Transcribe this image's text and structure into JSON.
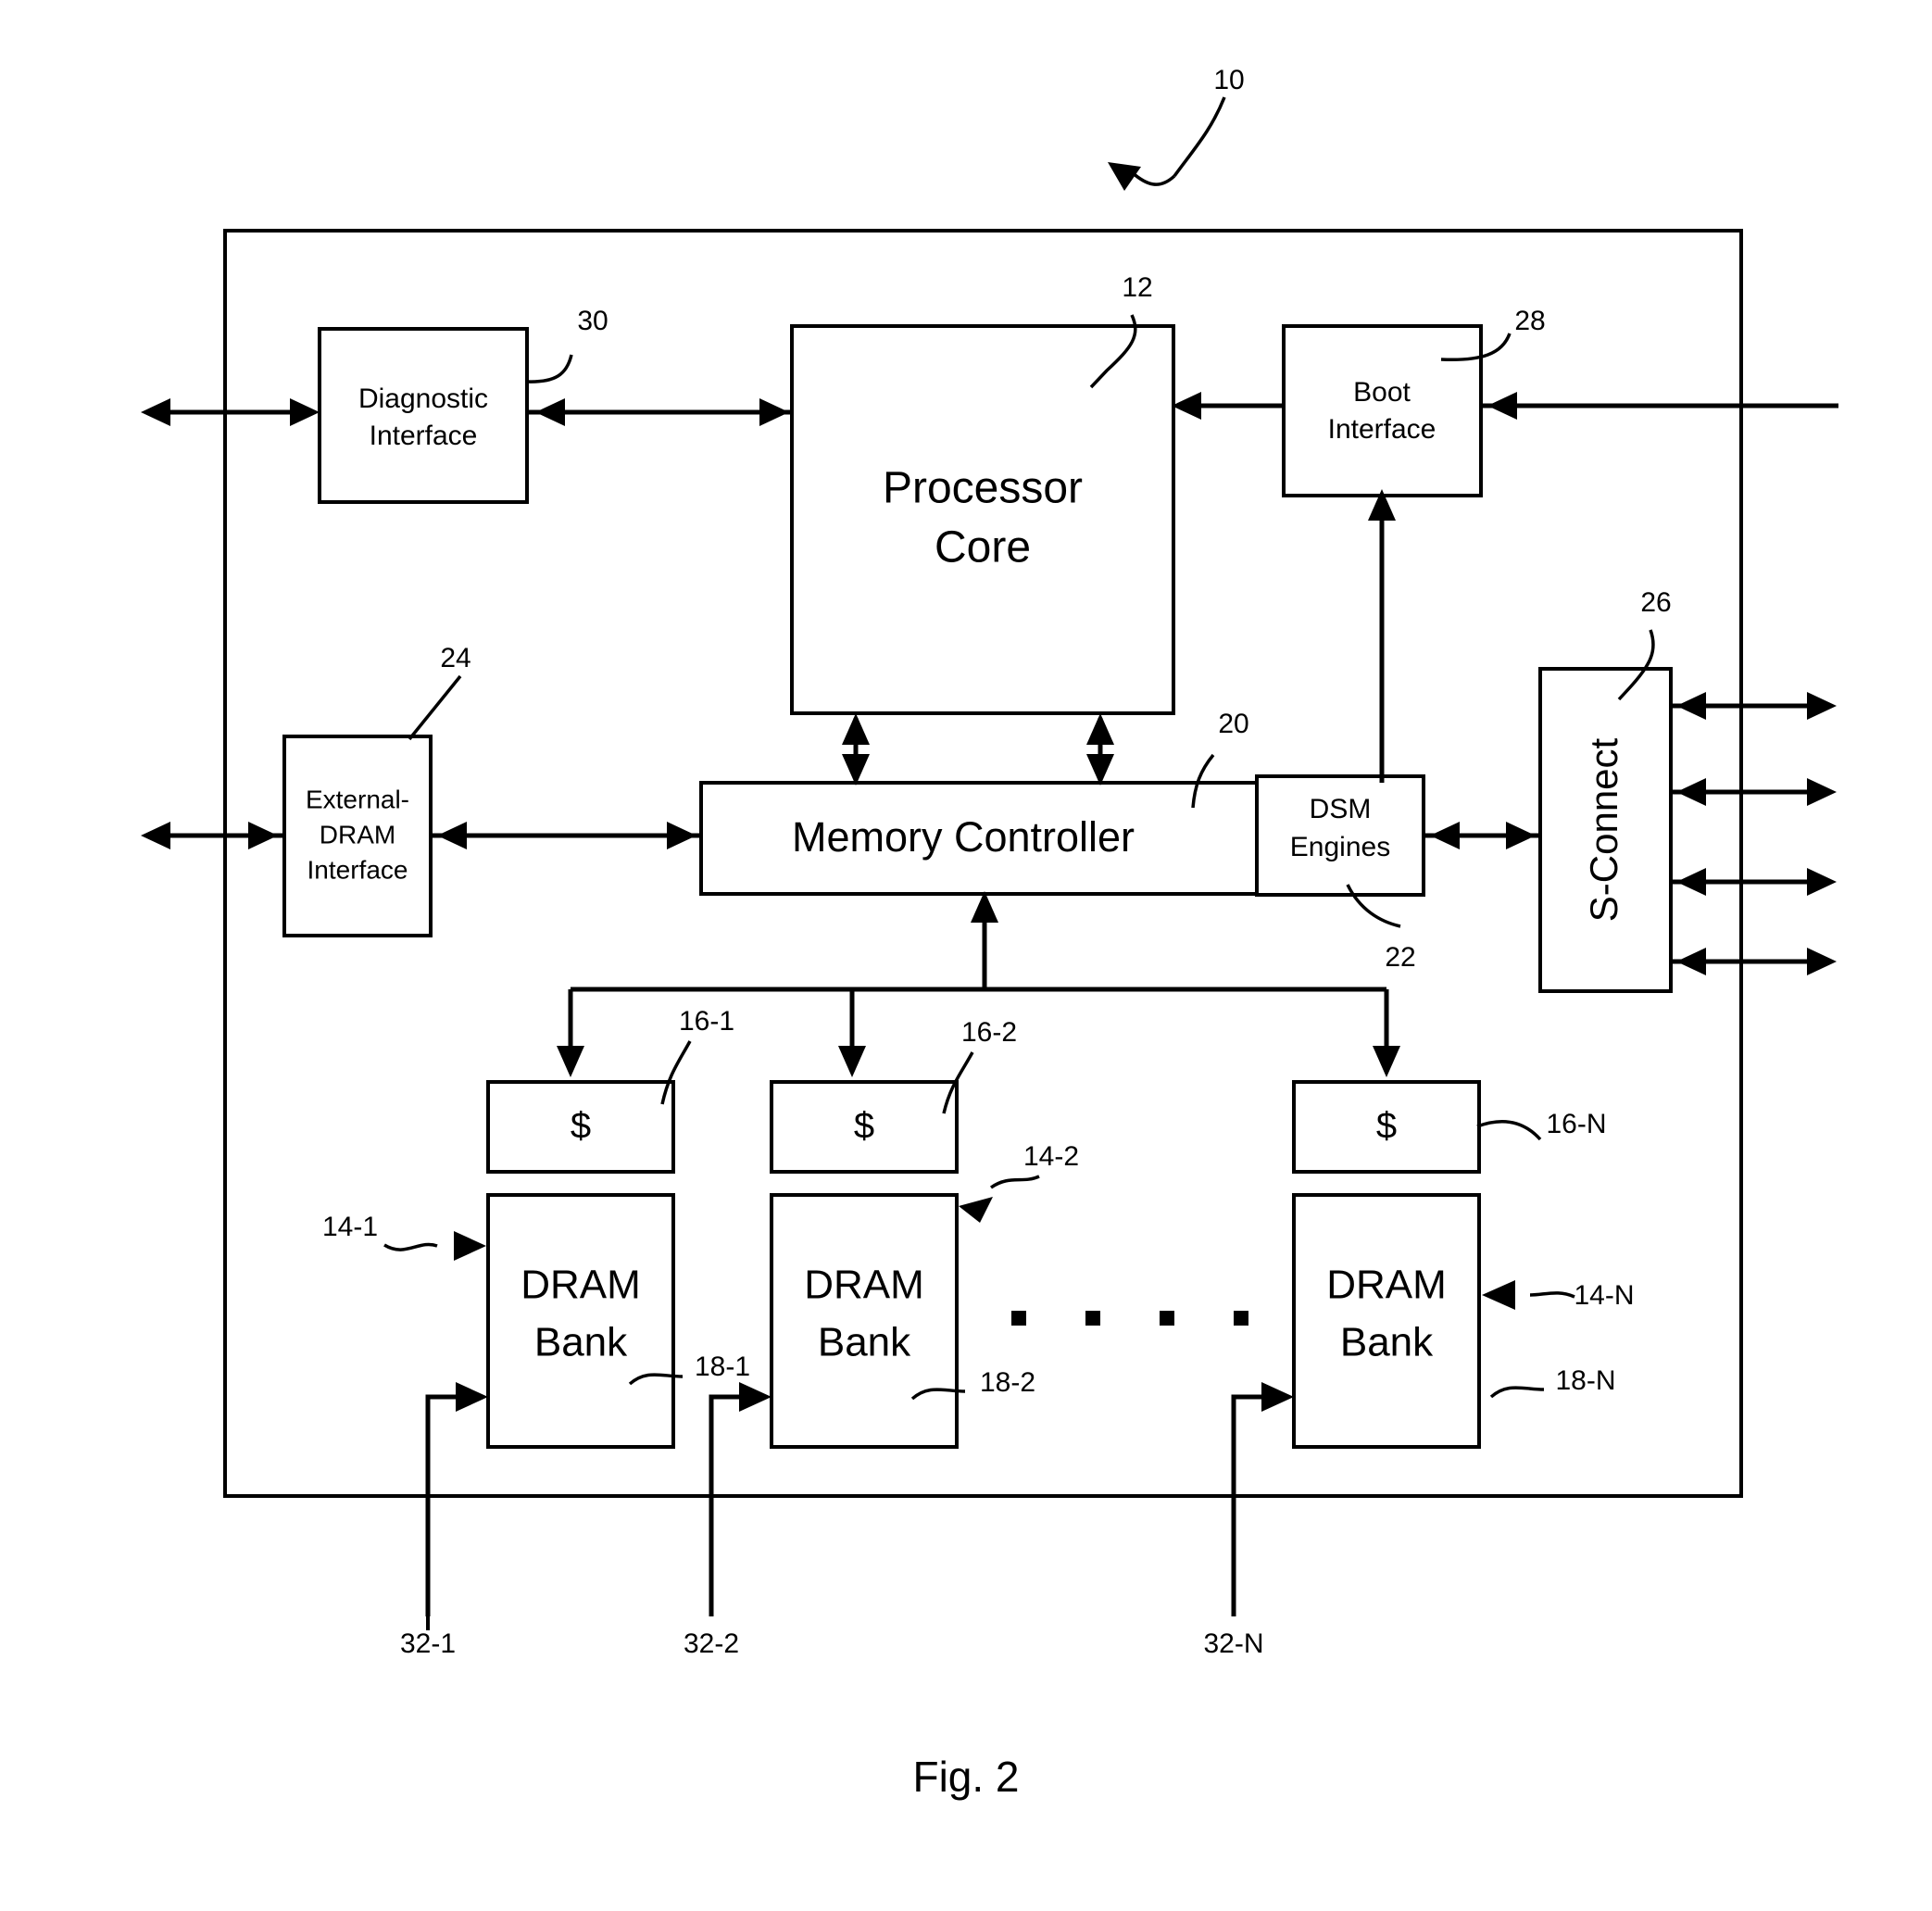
{
  "figure": {
    "caption": "Fig. 2",
    "chip_ref": "10"
  },
  "blocks": {
    "diagnostic_interface": {
      "line1": "Diagnostic",
      "line2": "Interface",
      "ref": "30"
    },
    "processor_core": {
      "line1": "Processor",
      "line2": "Core",
      "ref": "12"
    },
    "boot_interface": {
      "line1": "Boot",
      "line2": "Interface",
      "ref": "28"
    },
    "external_dram_interface": {
      "line1": "External-",
      "line2": "DRAM",
      "line3": "Interface",
      "ref": "24"
    },
    "memory_controller": {
      "label": "Memory Controller",
      "ref": "20"
    },
    "dsm_engines": {
      "line1": "DSM",
      "line2": "Engines",
      "ref": "22"
    },
    "s_connect": {
      "label": "S-Connect",
      "ref": "26"
    }
  },
  "caches": [
    {
      "label": "$",
      "ref": "16-1"
    },
    {
      "label": "$",
      "ref": "16-2"
    },
    {
      "label": "$",
      "ref": "16-N"
    }
  ],
  "dram_banks": [
    {
      "line1": "DRAM",
      "line2": "Bank",
      "ref_bank": "14-1",
      "ref_port": "18-1",
      "ref_bus": "32-1"
    },
    {
      "line1": "DRAM",
      "line2": "Bank",
      "ref_bank": "14-2",
      "ref_port": "18-2",
      "ref_bus": "32-2"
    },
    {
      "line1": "DRAM",
      "line2": "Bank",
      "ref_bank": "14-N",
      "ref_port": "18-N",
      "ref_bus": "32-N"
    }
  ],
  "ellipsis": "• • • •",
  "colors": {
    "ink": "#000000",
    "paper": "#ffffff"
  }
}
